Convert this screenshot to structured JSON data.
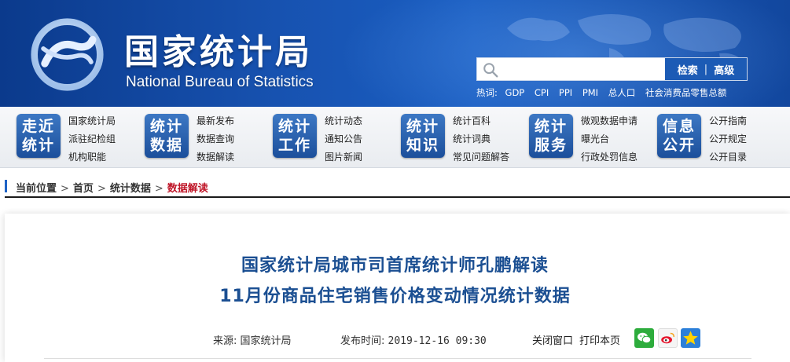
{
  "header": {
    "logo_cn": "国家统计局",
    "logo_en": "National Bureau of Statistics",
    "search": {
      "placeholder": "",
      "search_label": "检索",
      "advanced_label": "高级"
    },
    "hotwords_label": "热词:",
    "hotwords": [
      "GDP",
      "CPI",
      "PPI",
      "PMI",
      "总人口",
      "社会消费品零售总额"
    ]
  },
  "nav": [
    {
      "badge": [
        "走近",
        "统计"
      ],
      "links": [
        "国家统计局",
        "派驻纪检组",
        "机构职能"
      ]
    },
    {
      "badge": [
        "统计",
        "数据"
      ],
      "links": [
        "最新发布",
        "数据查询",
        "数据解读"
      ]
    },
    {
      "badge": [
        "统计",
        "工作"
      ],
      "links": [
        "统计动态",
        "通知公告",
        "图片新闻"
      ]
    },
    {
      "badge": [
        "统计",
        "知识"
      ],
      "links": [
        "统计百科",
        "统计词典",
        "常见问题解答"
      ]
    },
    {
      "badge": [
        "统计",
        "服务"
      ],
      "links": [
        "微观数据申请",
        "曝光台",
        "行政处罚信息"
      ]
    },
    {
      "badge": [
        "信息",
        "公开"
      ],
      "links": [
        "公开指南",
        "公开规定",
        "公开目录"
      ]
    }
  ],
  "breadcrumb": {
    "label": "当前位置",
    "items": [
      "首页",
      "统计数据",
      "数据解读"
    ],
    "arrow": ">"
  },
  "article": {
    "title_line1": "国家统计局城市司首席统计师孔鹏解读",
    "title_line2": "11月份商品住宅销售价格变动情况统计数据",
    "source_label": "来源:",
    "source_value": "国家统计局",
    "time_label": "发布时间:",
    "time_value": "2019-12-16 09:30",
    "close_label": "关闭窗口",
    "print_label": "打印本页"
  },
  "colors": {
    "header_blue": "#1752b0",
    "title_blue": "#1b4f92",
    "crumb_red": "#c0182a",
    "badge_blue": "#2a62b0"
  }
}
